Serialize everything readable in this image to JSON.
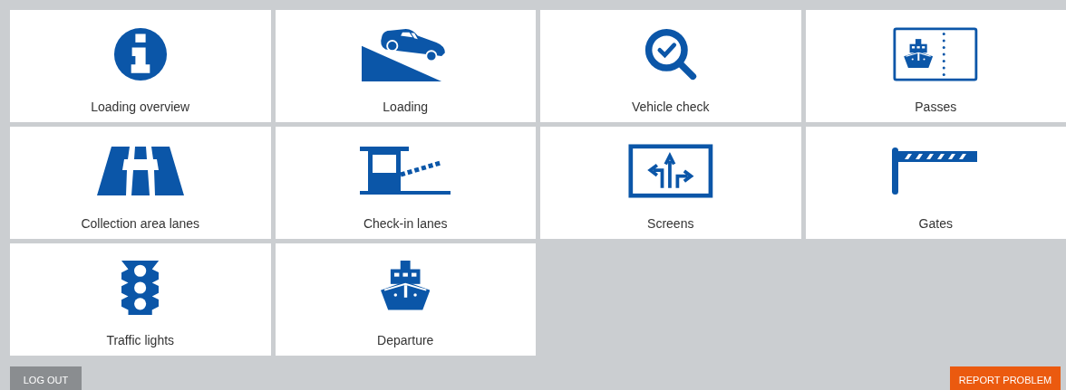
{
  "tiles": [
    {
      "label": "Loading overview",
      "kind": "info"
    },
    {
      "label": "Loading",
      "kind": "car-ramp"
    },
    {
      "label": "Vehicle check",
      "kind": "check-search"
    },
    {
      "label": "Passes",
      "kind": "ticket"
    },
    {
      "label": "Collection area lanes",
      "kind": "road"
    },
    {
      "label": "Check-in lanes",
      "kind": "booth"
    },
    {
      "label": "Screens",
      "kind": "screen"
    },
    {
      "label": "Gates",
      "kind": "gate"
    },
    {
      "label": "Traffic lights",
      "kind": "traffic-light"
    },
    {
      "label": "Departure",
      "kind": "ship"
    }
  ],
  "buttons": [
    {
      "label": "LOG OUT",
      "kind": "logout"
    },
    {
      "label": "REPORT PROBLEM",
      "kind": "report"
    }
  ]
}
